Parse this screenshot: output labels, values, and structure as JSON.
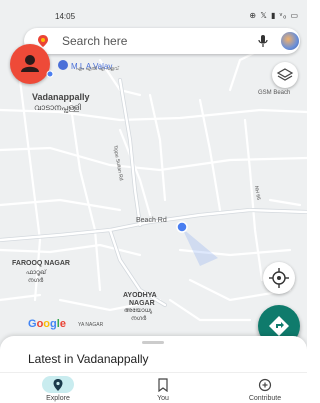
{
  "status_bar": {
    "time": "14:05",
    "icons": "⊕ 𝕏 ▮ ᵛₒ ▭"
  },
  "search": {
    "placeholder": "Search here"
  },
  "pinned_place": {
    "name": "M L A Valav",
    "sub": "എം എൽ എ വളവ്"
  },
  "map_labels": {
    "vadanappally": {
      "en": "Vadanappally",
      "ml": "വാടാനപ്പള്ളി"
    },
    "farooq_nagar": {
      "en": "FAROOQ NAGAR",
      "ml1": "ഫാറൂഖ്",
      "ml2": "നഗർ"
    },
    "ayodhya_nagar": {
      "en1": "AYODHYA",
      "en2": "NAGAR",
      "ml1": "അയോധ്യ",
      "ml2": "നഗർ"
    },
    "beach_rd": "Beach Rd",
    "gsm_beach": "GSM Beach",
    "side_rd_1": "Tippu Sultan Rd",
    "side_rd_2": "NH 66",
    "nagar_small": "YA NAGAR"
  },
  "google_logo": [
    "G",
    "o",
    "o",
    "g",
    "l",
    "e"
  ],
  "sheet": {
    "latest": "Latest in Vadanappally"
  },
  "bottom_nav": {
    "tabs": [
      {
        "label": "Explore",
        "icon": "location-pin-icon",
        "active": true
      },
      {
        "label": "You",
        "icon": "bookmark-icon",
        "active": false
      },
      {
        "label": "Contribute",
        "icon": "add-circle-icon",
        "active": false
      }
    ]
  },
  "colors": {
    "accent": "#0f7b6c",
    "avatar": "#ee4a38",
    "explore_pill": "#c9ecef",
    "blue_dot": "#4a7ef0"
  }
}
